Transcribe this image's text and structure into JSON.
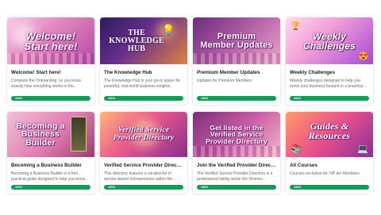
{
  "cards": [
    {
      "banner": "Welcome! Start here!",
      "title": "Welcome! Start here!",
      "description": "Complete the Onboarding, so you know exactly how everything works in the...",
      "progress_label": "100%",
      "progress": 1.0,
      "thumb_icon": "welcome-banner"
    },
    {
      "banner": "THE KNOWLEDGE HUB",
      "title": "The Knowledge Hub",
      "description": "The Knowledge Hub is your go-to space for powerful, real-world business insights. Insid...",
      "progress_label": "100%",
      "progress": 1.0,
      "thumb_icon": "lightbulb-books"
    },
    {
      "banner": "Premium Member Updates",
      "title": "Premium Member Updates",
      "description": "Updates for Premium Members",
      "progress_label": "100%",
      "progress": 1.0,
      "thumb_icon": "women-group"
    },
    {
      "banner": "Weekly Challenges",
      "title": "Weekly Challenges",
      "description": "Weekly challenges designed to help you move your business forward in a practical...",
      "progress_label": "100%",
      "progress": 1.0,
      "thumb_icon": "trophy-emoji"
    },
    {
      "banner": "Becoming a Business Builder",
      "title": "Becoming a Business Builder",
      "description": "Becoming a Business Builder is a free, practical guide designed to help you move...",
      "progress_label": "100%",
      "progress": 1.0,
      "thumb_icon": "book-cover"
    },
    {
      "banner": "Verified Service Provider Directory",
      "title": "Verified Service Provider Directory",
      "description": "This directory features a curated list of service-based entrepreneurs within the...",
      "progress_label": "100%",
      "progress": 1.0,
      "thumb_icon": "directory"
    },
    {
      "banner": "Get listed in the Verified Service Provider Directory",
      "title": "Join the Verified Provider Directory",
      "description": "The Verified Service Provider Directory is a professional listing inside the Women...",
      "progress_label": "100%",
      "progress": 1.0,
      "thumb_icon": "women-group"
    },
    {
      "banner": "Guides & Resources",
      "title": "All Courses",
      "description": "Courses exclusive for VIP tier Members",
      "progress_label": "100%",
      "progress": 1.0,
      "thumb_icon": "books-laptop"
    }
  ],
  "colors": {
    "progress": "#0f9d58",
    "title": "#222222",
    "desc": "#666666"
  }
}
